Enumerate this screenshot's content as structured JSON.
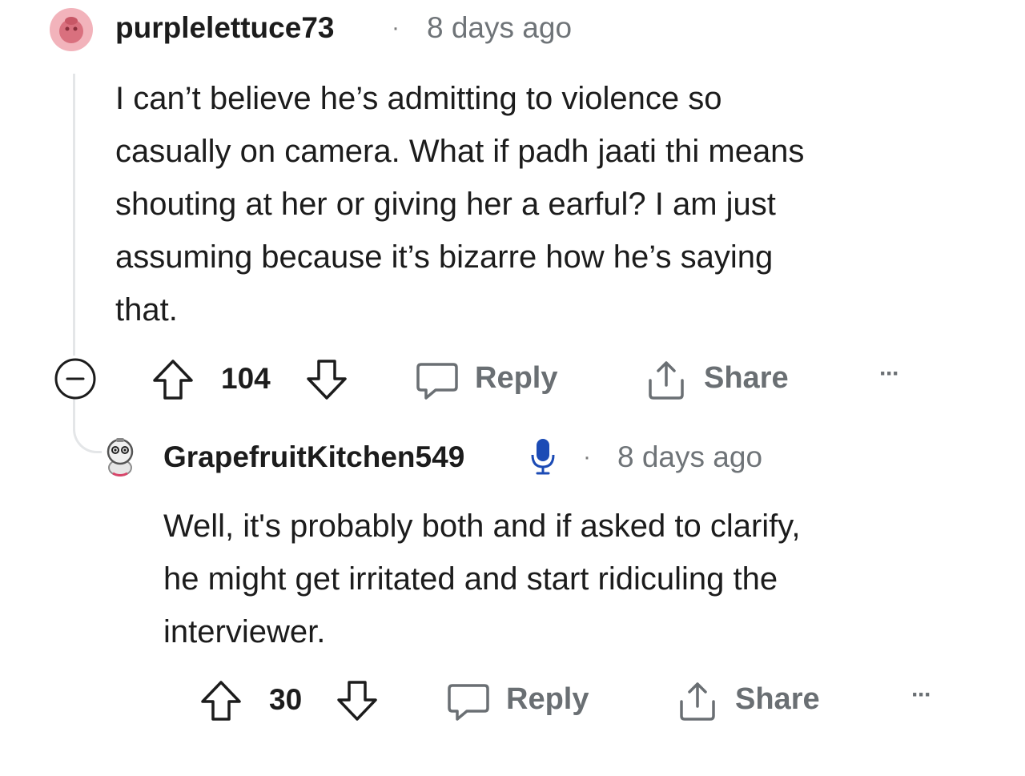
{
  "comments": [
    {
      "username": "purplelettuce73",
      "separator": "·",
      "time": "8 days ago",
      "lines": [
        "I can’t believe he’s admitting to violence so",
        "casually on camera. What if padh jaati thi means",
        "shouting at her or giving her a earful? I am just",
        "assuming because it’s bizarre how he’s saying",
        "that."
      ],
      "votes": "104",
      "reply_label": "Reply",
      "share_label": "Share",
      "more_label": "···"
    },
    {
      "username": "GrapefruitKitchen549",
      "separator": "·",
      "time": "8 days ago",
      "lines": [
        "Well, it's probably both and if asked to clarify,",
        "he might get irritated and start ridiculing the",
        "interviewer."
      ],
      "votes": "30",
      "reply_label": "Reply",
      "share_label": "Share",
      "more_label": "···"
    }
  ],
  "icons": {
    "avatar1": "avatar-icon",
    "avatar2": "avatar-icon",
    "collapse": "collapse-thread-icon",
    "upvote": "arrow-up-icon",
    "downvote": "arrow-down-icon",
    "reply": "comment-bubble-icon",
    "share": "share-upload-icon",
    "mic": "microphone-icon"
  },
  "colors": {
    "avatar1": "#e88a95",
    "mic": "#1c4bb5",
    "thread_line": "#e4e6e8",
    "muted_text": "#6f7478"
  }
}
